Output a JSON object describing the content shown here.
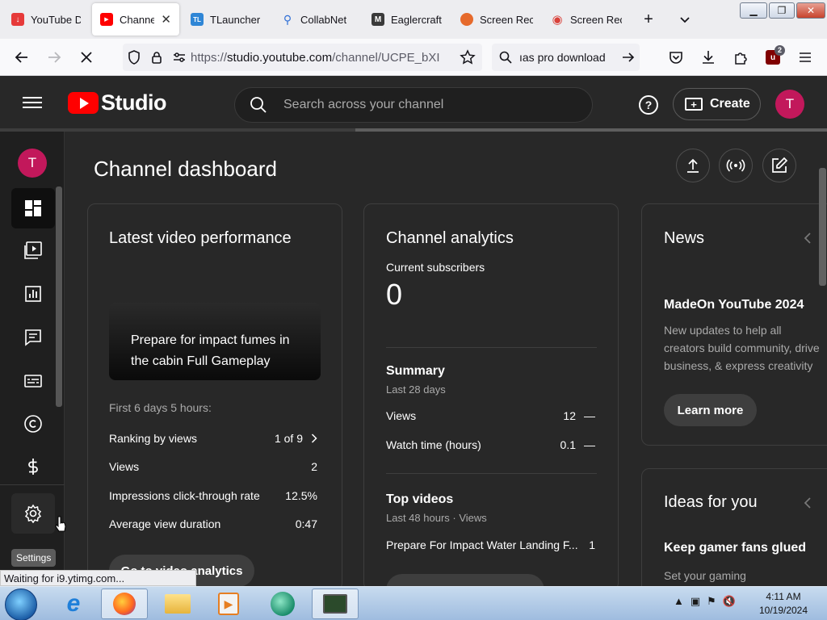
{
  "browser": {
    "tabs": [
      {
        "label": "YouTube D",
        "favicon_color": "#e63a3a",
        "favicon_glyph": "↓"
      },
      {
        "label": "Channel",
        "favicon_color": "#ff0000",
        "favicon_glyph": "▶"
      },
      {
        "label": "TLauncher",
        "favicon_color": "#2f86d6",
        "favicon_glyph": "TL"
      },
      {
        "label": "CollabNet",
        "favicon_color": "#ffffff",
        "favicon_glyph": "🔍"
      },
      {
        "label": "Eaglercraft",
        "favicon_color": "#3a3a3a",
        "favicon_glyph": "M"
      },
      {
        "label": "Screen Rec",
        "favicon_color": "#e66a2c",
        "favicon_glyph": "●"
      },
      {
        "label": "Screen Rec",
        "favicon_color": "#ffffff",
        "favicon_glyph": "◉"
      }
    ],
    "new_tab": "+",
    "tab_list": "⌄",
    "url_domain": "studio.youtube.com",
    "url_prefix": "https://",
    "url_path": "/channel/UCPE_bXI",
    "search_text": "ıas pro download",
    "extension_badge": "2",
    "status_text": "Waiting for i9.ytimg.com..."
  },
  "studio": {
    "logo_word": "Studio",
    "search_placeholder": "Search across your channel",
    "create_label": "Create",
    "avatar_letter": "T",
    "help_glyph": "?",
    "page_title": "Channel dashboard",
    "settings_tooltip": "Settings",
    "load_progress": 0.43
  },
  "latest_video": {
    "title": "Latest video performance",
    "video_title": "Prepare for impact fumes in the cabin Full Gameplay",
    "period": "First 6 days 5 hours:",
    "rows": [
      {
        "label": "Ranking by views",
        "value": "1 of 9"
      },
      {
        "label": "Views",
        "value": "2"
      },
      {
        "label": "Impressions click-through rate",
        "value": "12.5%"
      },
      {
        "label": "Average view duration",
        "value": "0:47"
      }
    ],
    "button_label": "Go to video analytics"
  },
  "analytics": {
    "title": "Channel analytics",
    "subs_label": "Current subscribers",
    "subs_value": "0",
    "summary_title": "Summary",
    "summary_period": "Last 28 days",
    "summary_rows": [
      {
        "label": "Views",
        "value": "12",
        "trend": "—"
      },
      {
        "label": "Watch time (hours)",
        "value": "0.1",
        "trend": "—"
      }
    ],
    "top_title": "Top videos",
    "top_period": "Last 48 hours · Views",
    "top_rows": [
      {
        "label": "Prepare For Impact Water Landing F...",
        "value": "1"
      }
    ]
  },
  "news": {
    "title": "News",
    "headline": "MadeOn YouTube 2024",
    "body": "New updates to help all creators build community, drive business, & express creativity on YouTube",
    "button_label": "Learn more"
  },
  "ideas": {
    "title": "Ideas for you",
    "headline": "Keep gamer fans glued",
    "body": "Set your gaming"
  },
  "taskbar": {
    "time": "4:11 AM",
    "date": "10/19/2024"
  }
}
